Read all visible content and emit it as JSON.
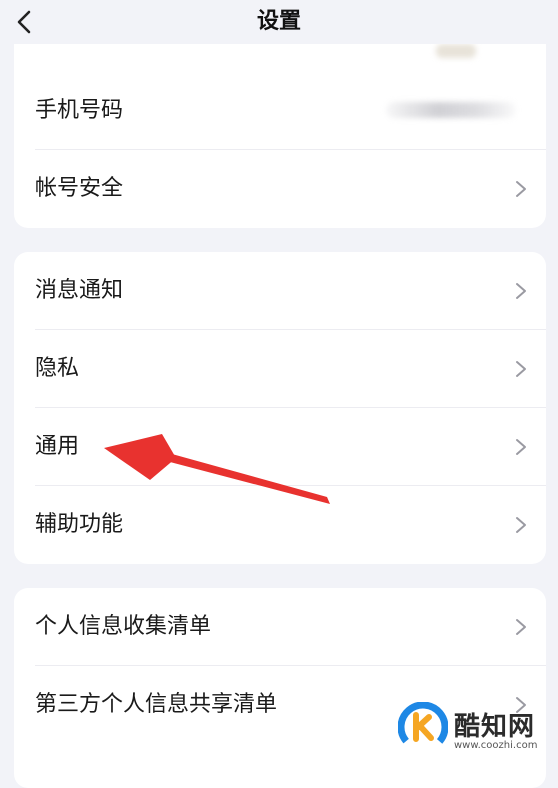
{
  "header": {
    "title": "设置"
  },
  "account_section": {
    "items": [
      {
        "label": "手机号码",
        "value_hidden": true
      },
      {
        "label": "帐号安全"
      }
    ]
  },
  "main_section": {
    "items": [
      {
        "label": "消息通知"
      },
      {
        "label": "隐私"
      },
      {
        "label": "通用"
      },
      {
        "label": "辅助功能"
      }
    ]
  },
  "info_section": {
    "items": [
      {
        "label": "个人信息收集清单"
      },
      {
        "label": "第三方个人信息共享清单"
      }
    ]
  },
  "annotation": {
    "color": "#e8322f",
    "points_to": "通用"
  },
  "watermark": {
    "title": "酷知网",
    "url": "www.coozhi.com",
    "logo_colors": [
      "#1e88e5",
      "#f5a623"
    ]
  }
}
